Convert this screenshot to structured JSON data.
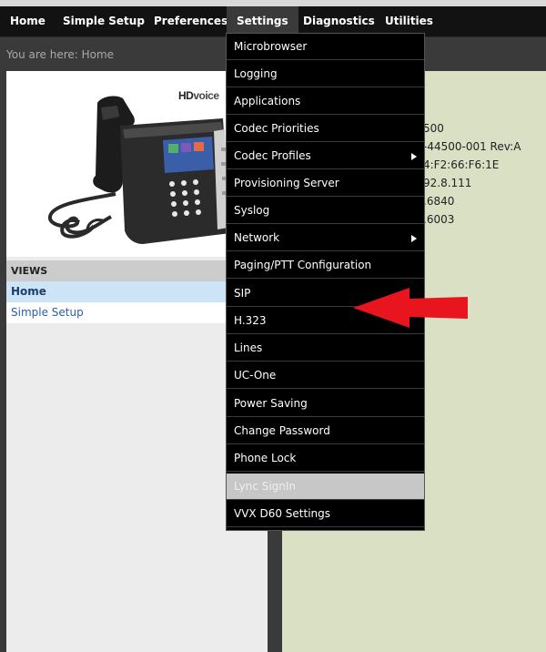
{
  "nav": {
    "items": [
      {
        "label": "Home"
      },
      {
        "label": "Simple Setup"
      },
      {
        "label": "Preferences"
      },
      {
        "label": "Settings",
        "active": true
      },
      {
        "label": "Diagnostics"
      },
      {
        "label": "Utilities"
      }
    ]
  },
  "breadcrumb": "You are here: Home",
  "phone_image": {
    "brand_text_hd": "HD",
    "brand_text_voice": "voice"
  },
  "views": {
    "header": "VIEWS",
    "items": [
      {
        "label": "Home",
        "selected": true
      },
      {
        "label": "Simple Setup"
      }
    ]
  },
  "info": {
    "lines": [
      "500",
      "-44500-001 Rev:A",
      "4:F2:66:F6:1E",
      "92.8.111",
      ".6840",
      ".6003"
    ]
  },
  "settings_menu": {
    "items": [
      {
        "label": "Microbrowser"
      },
      {
        "label": "Logging"
      },
      {
        "label": "Applications"
      },
      {
        "label": "Codec Priorities"
      },
      {
        "label": "Codec Profiles",
        "submenu": true
      },
      {
        "label": "Provisioning Server"
      },
      {
        "label": "Syslog"
      },
      {
        "label": "Network",
        "submenu": true
      },
      {
        "label": "Paging/PTT Configuration"
      },
      {
        "label": "SIP"
      },
      {
        "label": "H.323"
      },
      {
        "label": "Lines"
      },
      {
        "label": "UC-One"
      },
      {
        "label": "Power Saving"
      },
      {
        "label": "Change Password"
      },
      {
        "label": "Phone Lock"
      },
      {
        "label": "Lync SignIn",
        "disabled": true
      },
      {
        "label": "VVX D60 Settings"
      }
    ]
  },
  "colors": {
    "nav_bg": "#121212",
    "menu_bg": "#000000",
    "right_panel_bg": "#d9e0c4",
    "annotation_arrow": "#e8141e"
  }
}
